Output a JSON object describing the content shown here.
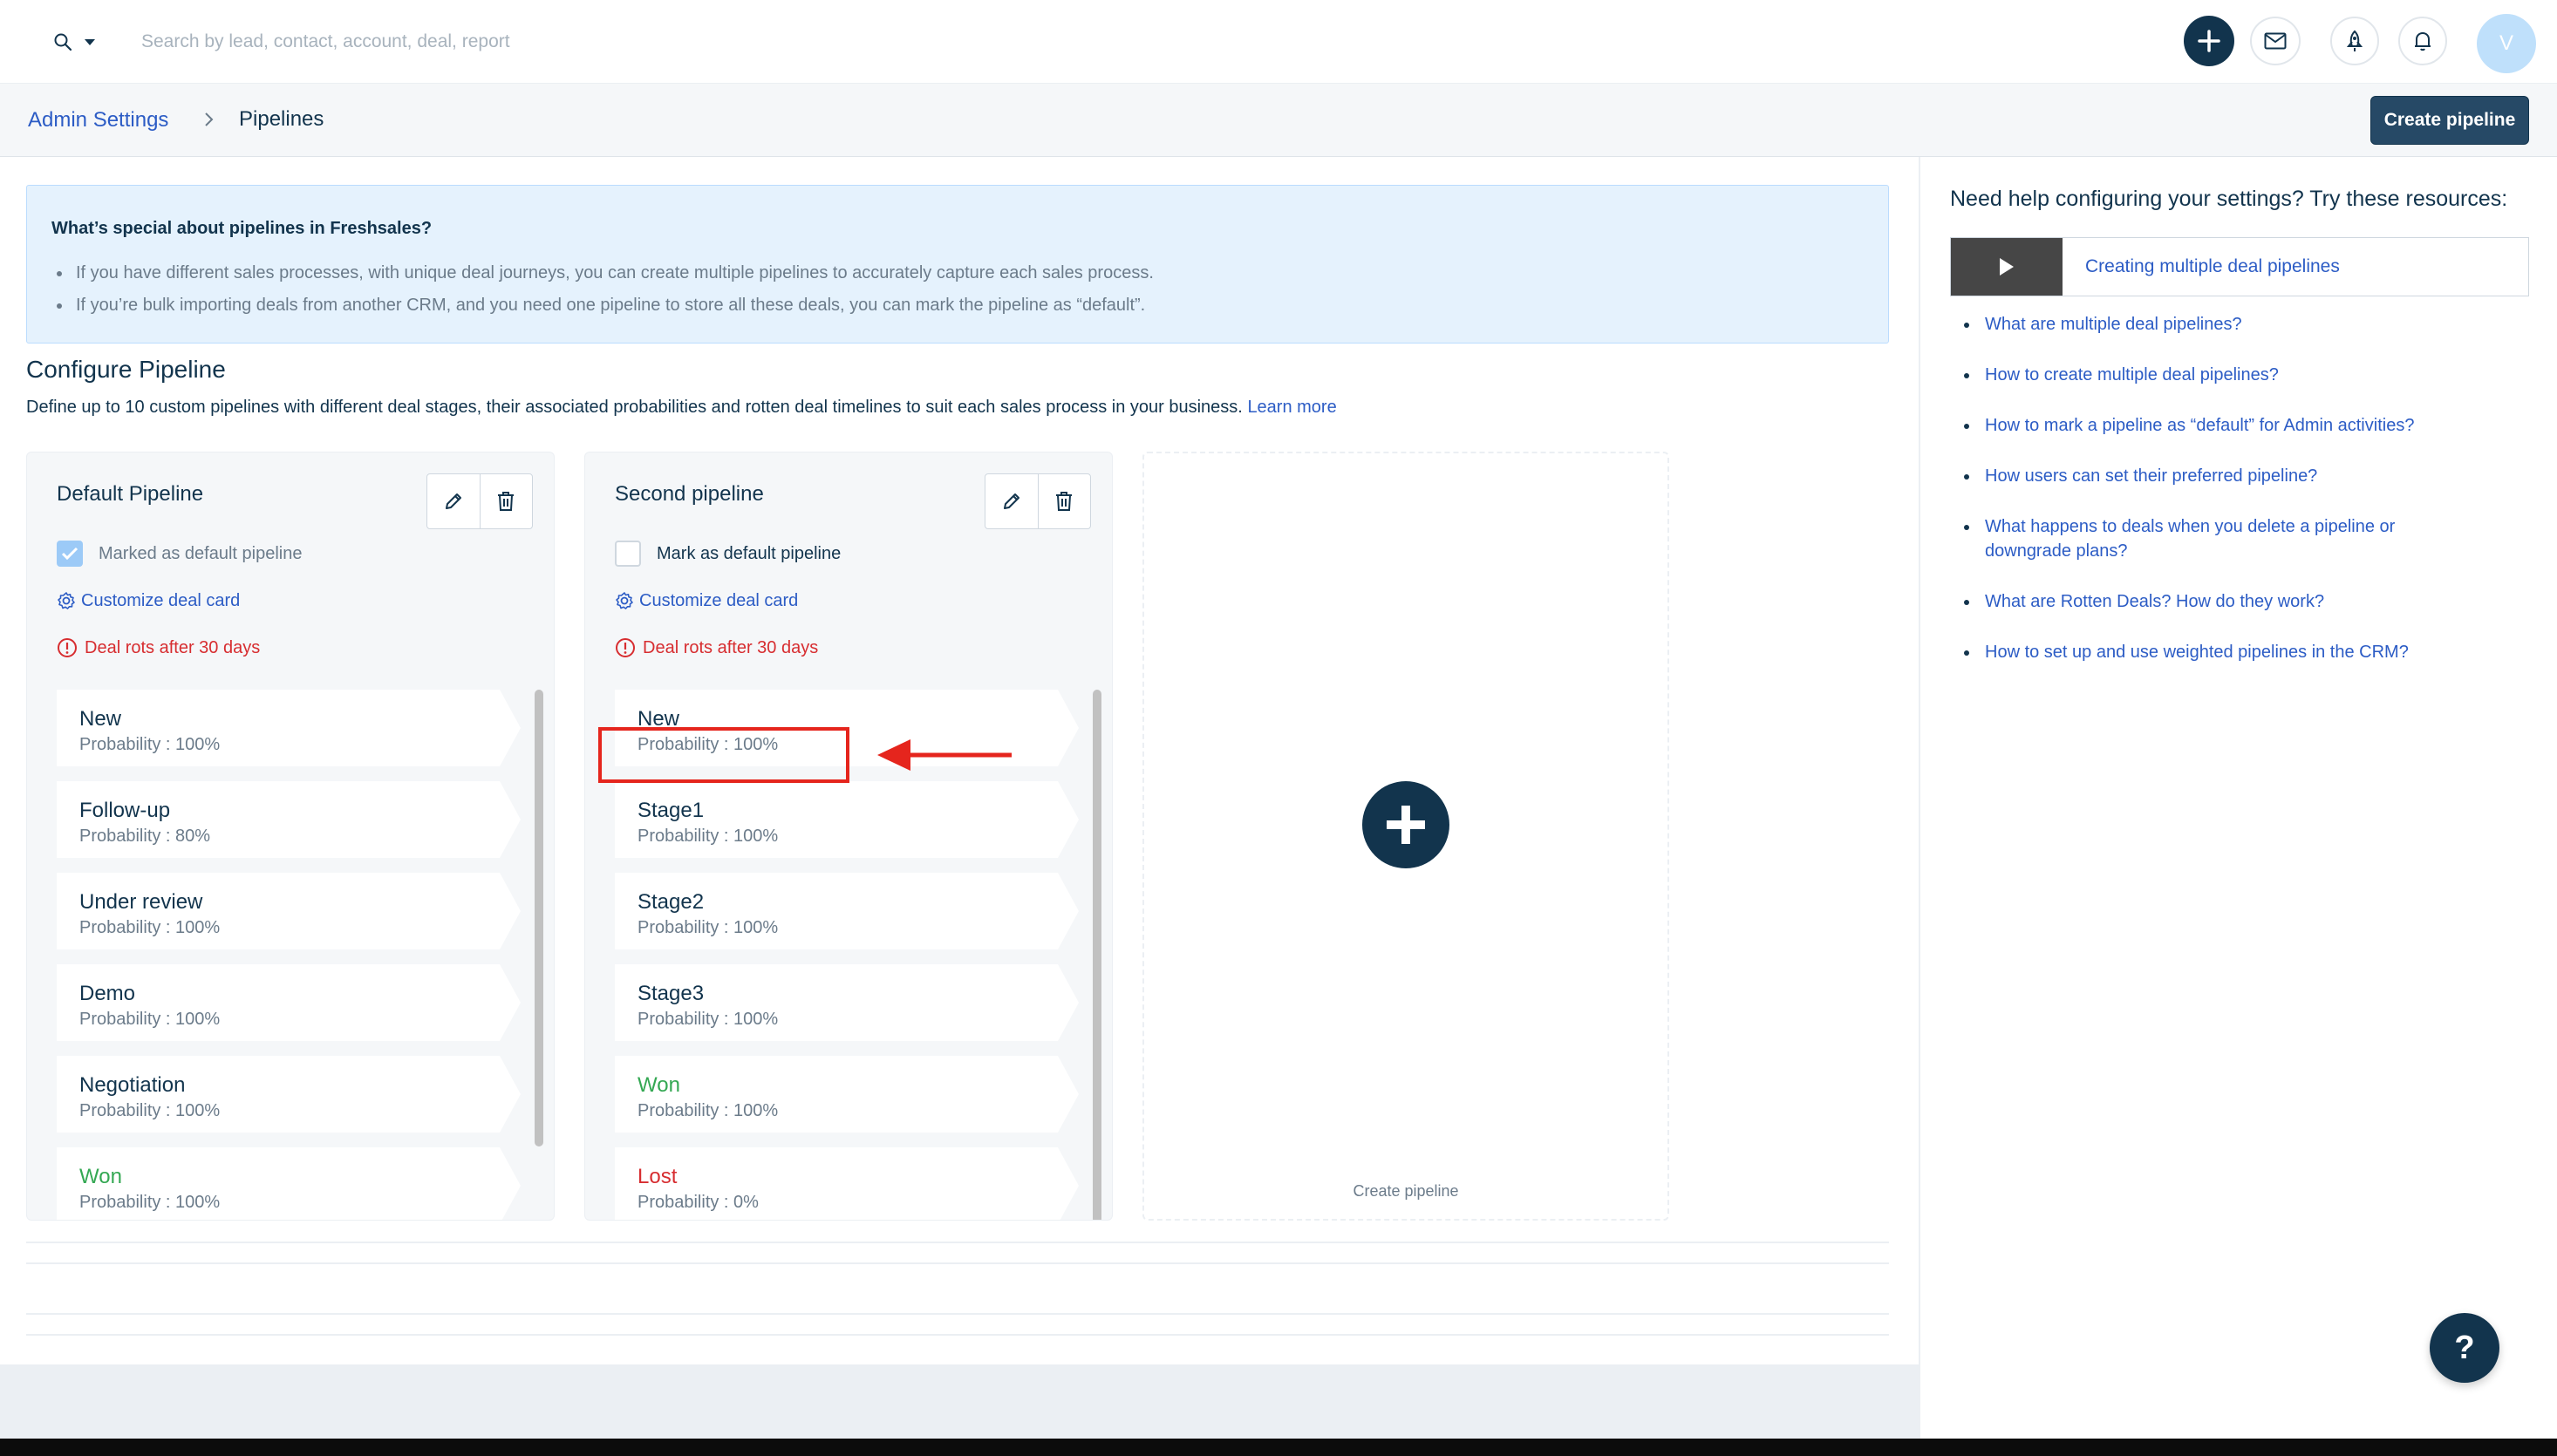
{
  "search": {
    "placeholder": "Search by lead, contact, account, deal, report"
  },
  "topbar": {
    "avatar_initial": "V"
  },
  "breadcrumb": {
    "parent": "Admin Settings",
    "current": "Pipelines"
  },
  "header": {
    "create_pipeline_label": "Create pipeline"
  },
  "info": {
    "title": "What’s special about pipelines in Freshsales?",
    "points": [
      "If you have different sales processes, with unique deal journeys, you can create multiple pipelines to accurately capture each sales process.",
      "If you’re bulk importing deals from another CRM, and you need one pipeline to store all these deals, you can mark the pipeline as “default”."
    ]
  },
  "configure": {
    "title": "Configure Pipeline",
    "description": "Define up to 10 custom pipelines with different deal stages, their associated probabilities and rotten deal timelines to suit each sales process in your business.",
    "learn_more": "Learn more"
  },
  "pipelines": [
    {
      "name": "Default Pipeline",
      "default_label": "Marked as default pipeline",
      "is_default": true,
      "customize_label": "Customize deal card",
      "rot_label": "Deal rots after 30 days",
      "stages": [
        {
          "name": "New",
          "probability": "Probability : 100%"
        },
        {
          "name": "Follow-up",
          "probability": "Probability : 80%"
        },
        {
          "name": "Under review",
          "probability": "Probability : 100%"
        },
        {
          "name": "Demo",
          "probability": "Probability : 100%"
        },
        {
          "name": "Negotiation",
          "probability": "Probability : 100%"
        },
        {
          "name": "Won",
          "probability": "Probability : 100%"
        }
      ]
    },
    {
      "name": "Second pipeline",
      "default_label": "Mark as default pipeline",
      "is_default": false,
      "customize_label": "Customize deal card",
      "rot_label": "Deal rots after 30 days",
      "stages": [
        {
          "name": "New",
          "probability": "Probability : 100%"
        },
        {
          "name": "Stage1",
          "probability": "Probability : 100%"
        },
        {
          "name": "Stage2",
          "probability": "Probability : 100%"
        },
        {
          "name": "Stage3",
          "probability": "Probability : 100%"
        },
        {
          "name": "Won",
          "probability": "Probability : 100%"
        },
        {
          "name": "Lost",
          "probability": "Probability : 0%"
        }
      ]
    }
  ],
  "create_card": {
    "label": "Create pipeline"
  },
  "help": {
    "title": "Need help configuring your settings? Try these resources:",
    "video_label": "Creating multiple deal pipelines",
    "links": [
      "What are multiple deal pipelines?",
      "How to create multiple deal pipelines?",
      "How to mark a pipeline as “default” for Admin activities?",
      "How users can set their preferred pipeline?",
      "What happens to deals when you delete a pipeline or downgrade plans?",
      "What are Rotten Deals? How do they work?",
      "How to set up and use weighted pipelines in the CRM?"
    ],
    "fab_label": "?"
  },
  "colors": {
    "brand_dark": "#12344d",
    "link": "#2c5cc5",
    "danger": "#d72d30",
    "won": "#34a853",
    "highlight": "#e5251d"
  }
}
